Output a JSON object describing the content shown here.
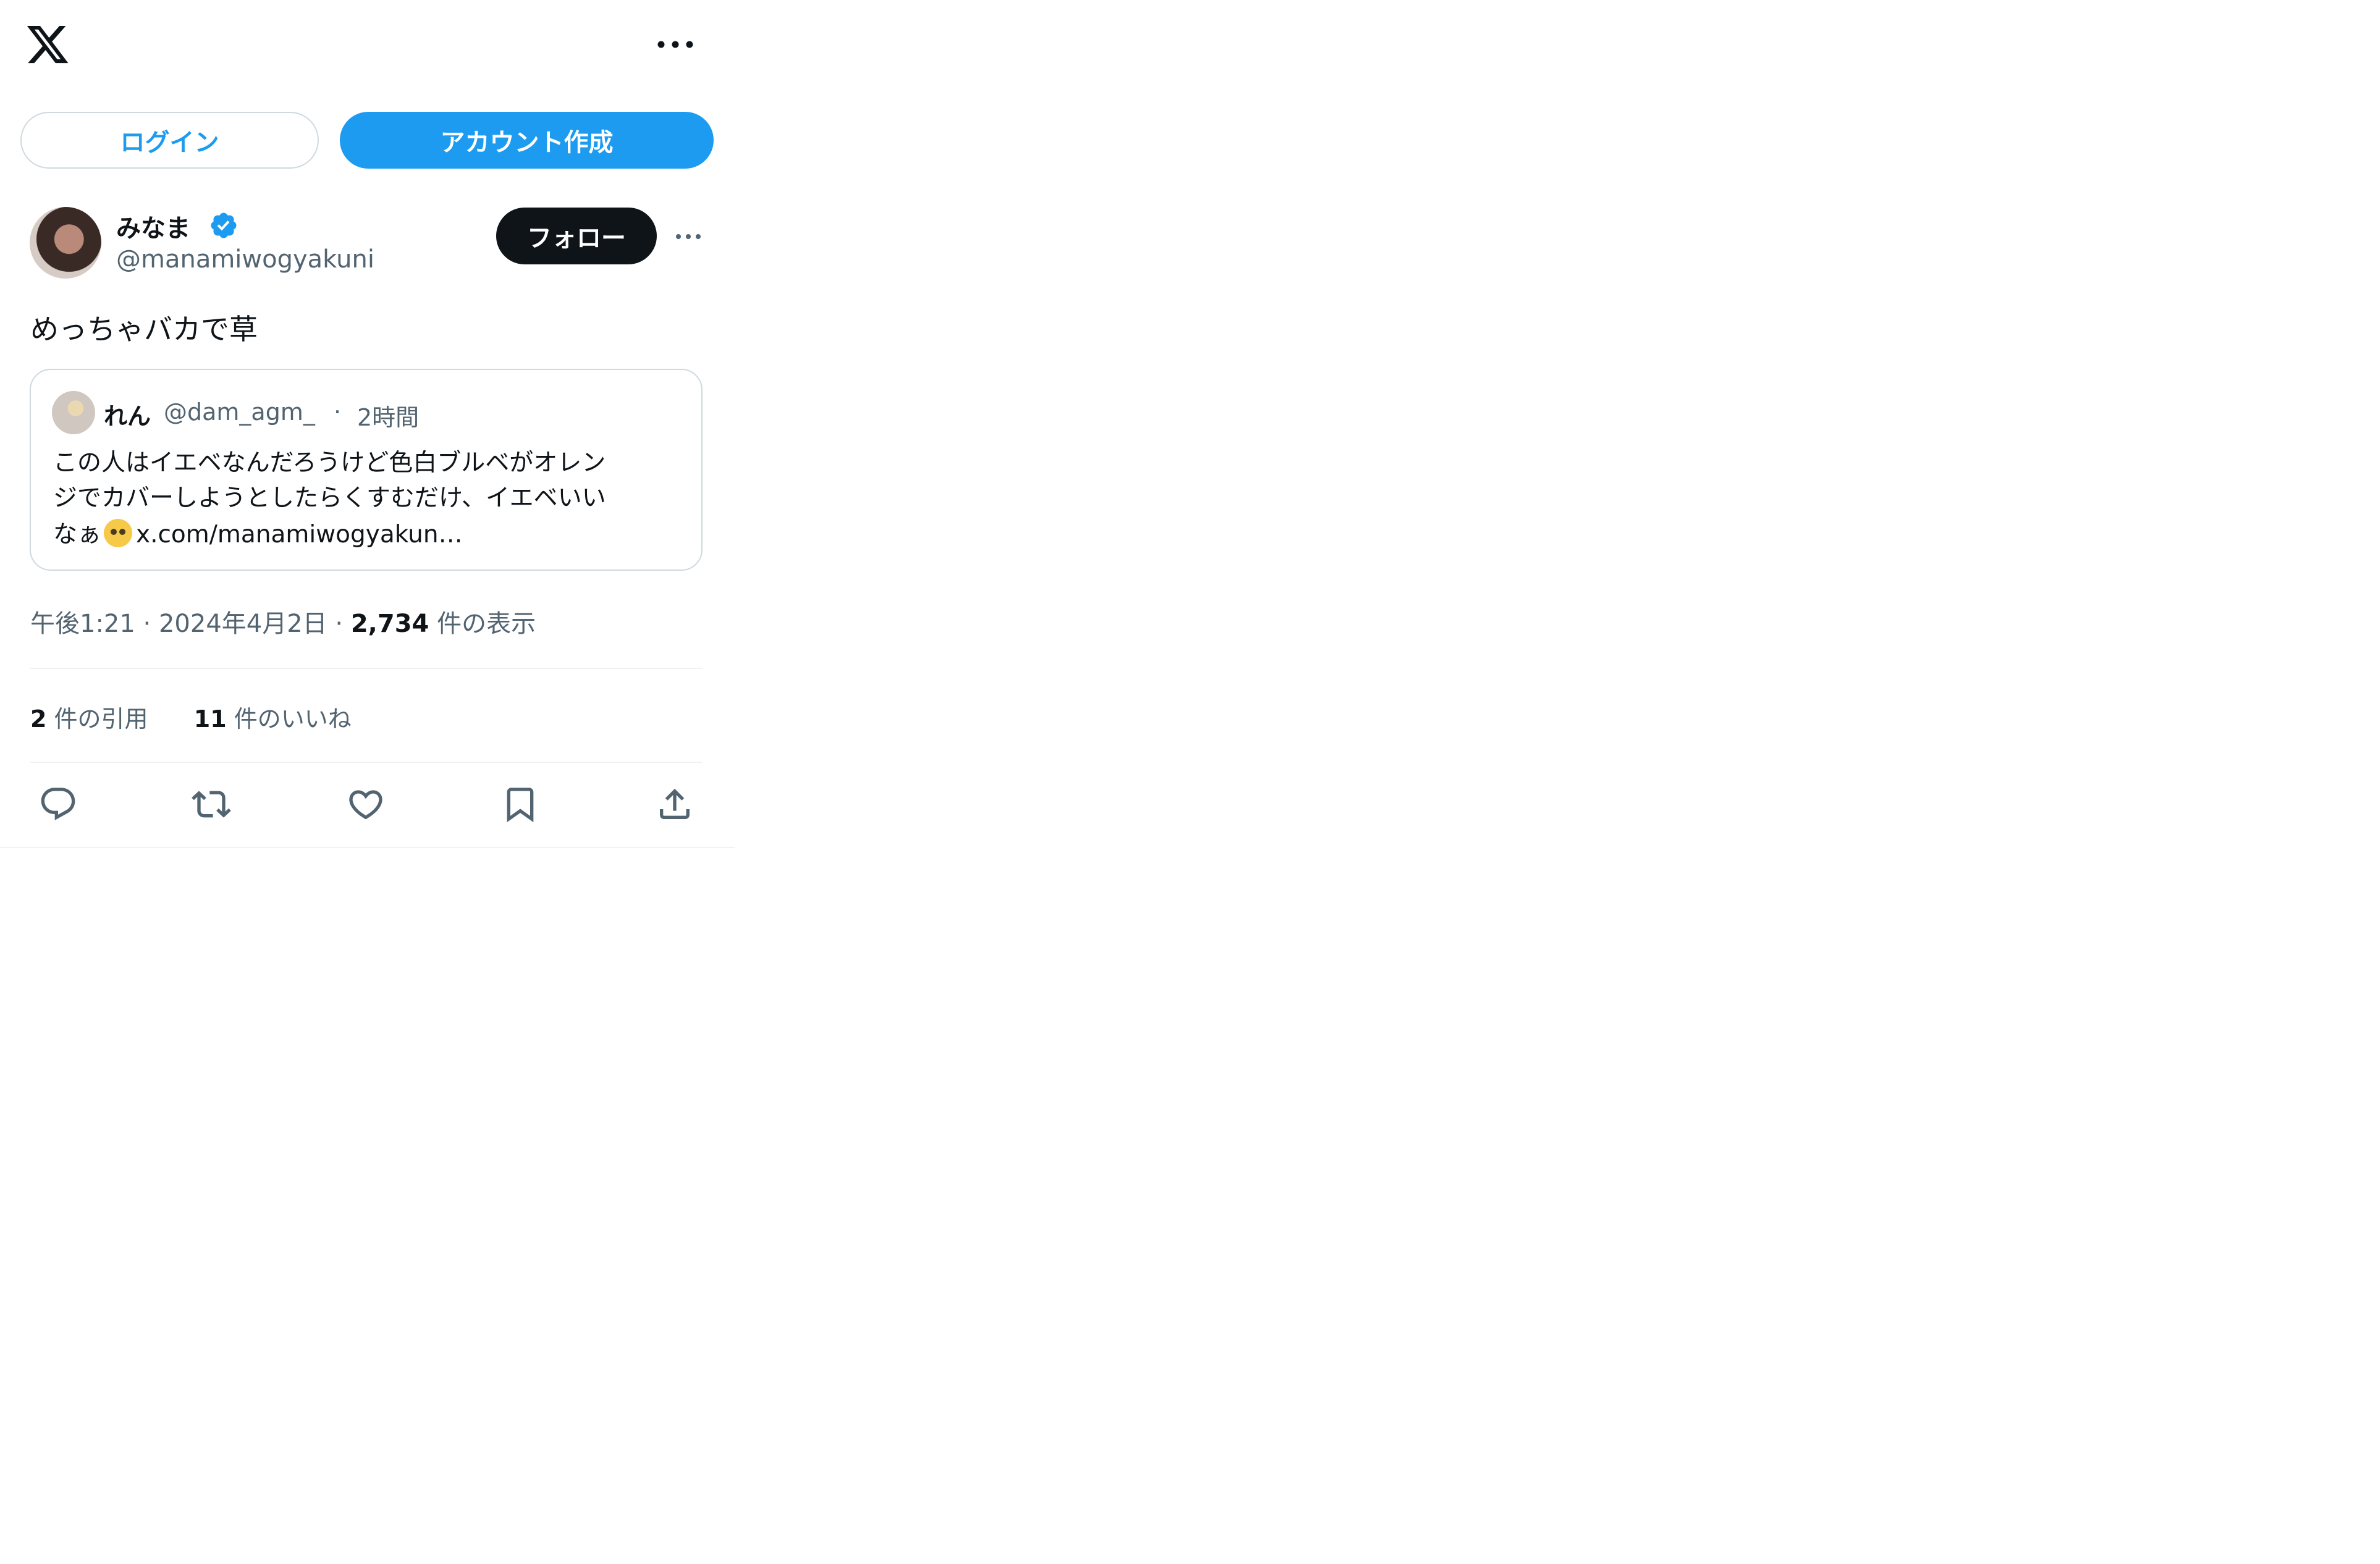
{
  "header": {
    "logo": "x-logo-icon",
    "more_icon": "more-horizontal-icon"
  },
  "auth": {
    "login_label": "ログイン",
    "signup_label": "アカウント作成"
  },
  "tweet": {
    "author_name": "みなま",
    "verified_icon": "verified-badge-icon",
    "author_handle": "@manamiwogyakuni",
    "follow_label": "フォロー",
    "text": "めっちゃバカで草",
    "quote": {
      "author_name": "れん",
      "author_handle": "@dam_agm_",
      "separator": "·",
      "time": "2時間",
      "line1": "この人はイエベなんだろうけど色白ブルベがオレン",
      "line2": "ジでカバーしようとしたらくすむだけ、イエベいい",
      "line3_prefix": "なぁ",
      "emoji": "pleading-face-emoji",
      "line3_link": "x.com/manamiwogyakun…"
    },
    "time": "午後1:21",
    "date": "2024年4月2日",
    "views_count": "2,734",
    "views_label": "件の表示",
    "quotes_count": "2",
    "quotes_label": "件の引用",
    "likes_count": "11",
    "likes_label": "件のいいね",
    "separator": "·"
  },
  "actions": [
    "reply-icon",
    "retweet-icon",
    "like-icon",
    "bookmark-icon",
    "share-icon"
  ],
  "colors": {
    "accent": "#1d9bf0",
    "text": "#0f1419",
    "secondary": "#536471",
    "border": "#cfd9de"
  }
}
